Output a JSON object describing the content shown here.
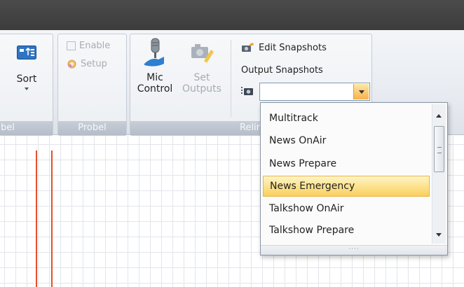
{
  "ribbon": {
    "sort_label": "Sort",
    "group1_label": "bel",
    "probel_group": {
      "enable_label": "Enable",
      "setup_label": "Setup",
      "label": "Probel"
    },
    "relink_group": {
      "mic_control_line1": "Mic",
      "mic_control_line2": "Control",
      "set_outputs_line1": "Set",
      "set_outputs_line2": "Outputs",
      "edit_snapshots_label": "Edit Snapshots",
      "output_snapshots_label": "Output Snapshots",
      "label": "Relin",
      "snapshot_value": ""
    }
  },
  "dropdown": {
    "items": [
      "Multitrack",
      "News OnAir",
      "News Prepare",
      "News Emergency",
      "Talkshow OnAir",
      "Talkshow Prepare"
    ],
    "selected": "News Emergency",
    "grip": "····"
  },
  "colors": {
    "highlight": "#f9cf5d",
    "red_lines": "#e2502b",
    "title_bar": "#424242"
  }
}
